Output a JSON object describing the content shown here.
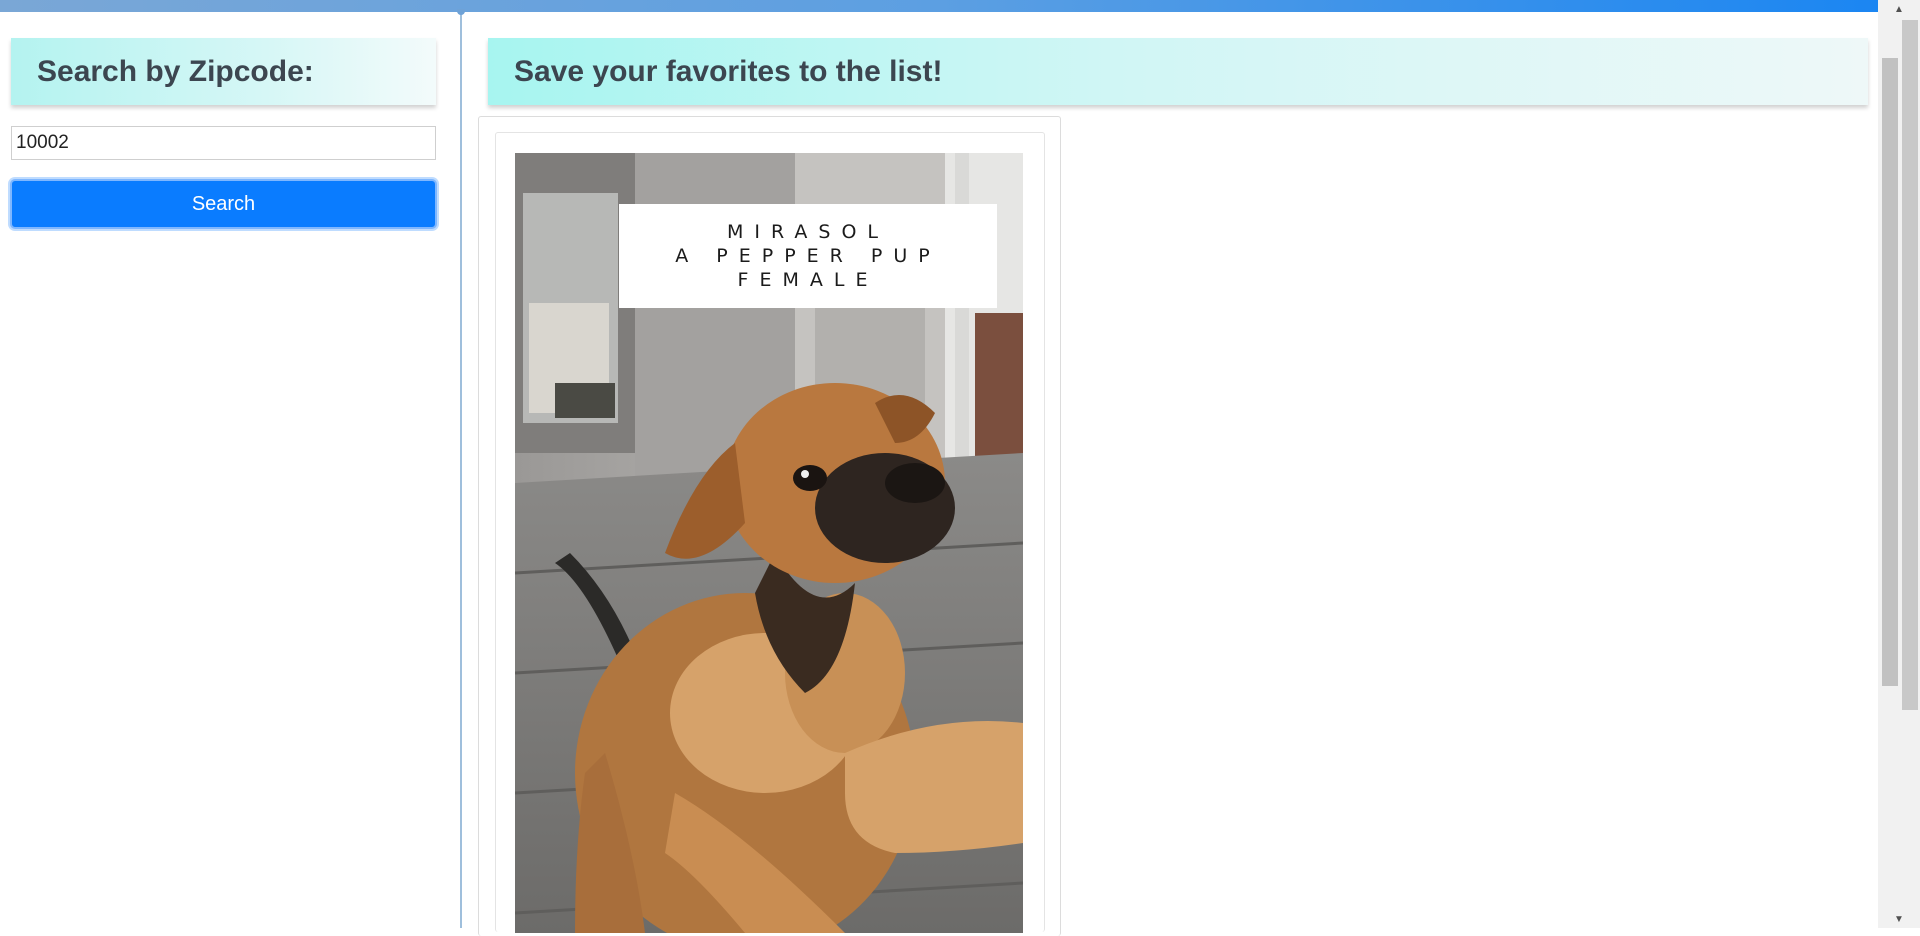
{
  "sidebar": {
    "title": "Search by Zipcode:",
    "zip_value": "10002",
    "search_label": "Search"
  },
  "main": {
    "title": "Save your favorites to the list!",
    "pet": {
      "caption_line1": "MIRASOL",
      "caption_line2": "A PEPPER PUP",
      "caption_line3": "FEMALE",
      "photo_subject": "puppy-photo"
    }
  },
  "colors": {
    "accent": "#0a7cff",
    "header_gradient_start": "#a7f5f0",
    "topbar": "#1b86f2"
  },
  "scrollbar": {
    "up_icon": "▲",
    "down_icon": "▼"
  }
}
